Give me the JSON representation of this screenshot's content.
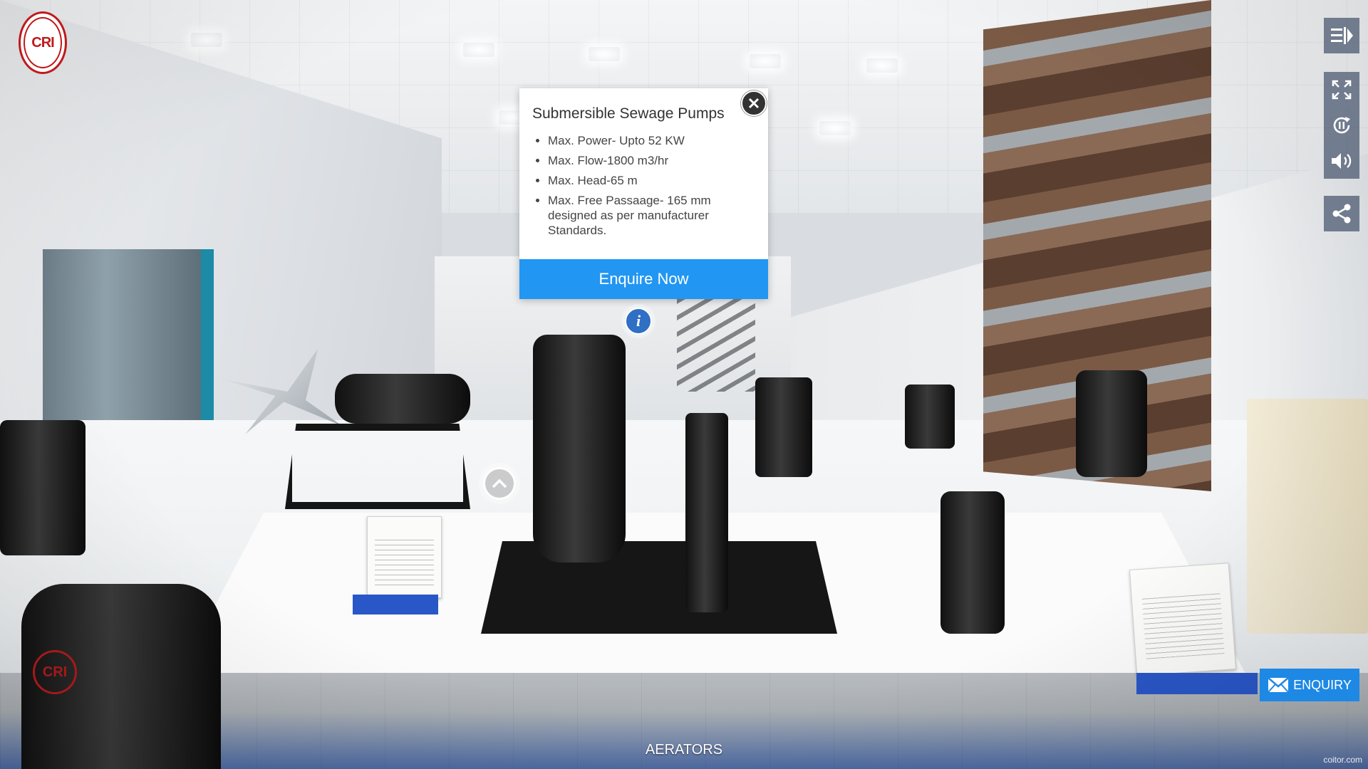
{
  "brand": {
    "logo_text": "CRI"
  },
  "popup": {
    "title": "Submersible Sewage Pumps",
    "specs": [
      "Max. Power- Upto 52 KW",
      "Max. Flow-1800 m3/hr",
      "Max. Head-65 m",
      "Max. Free Passaage- 165 mm designed as per manufacturer Standards."
    ],
    "enquire_label": "Enquire Now"
  },
  "toolbar": {
    "icons": [
      "playlist-toggle-icon",
      "fullscreen-icon",
      "autorotate-pause-icon",
      "sound-icon",
      "share-icon"
    ]
  },
  "hotspots": {
    "info_glyph": "i"
  },
  "enquiry": {
    "label": "ENQUIRY"
  },
  "scene": {
    "name": "AERATORS"
  },
  "watermark": "coitor.com",
  "colors": {
    "enquire_blue": "#2196f3",
    "enquiry_blue": "#1e88e5",
    "brand_red": "#c0191c",
    "toolbar_bg": "#46546e"
  }
}
